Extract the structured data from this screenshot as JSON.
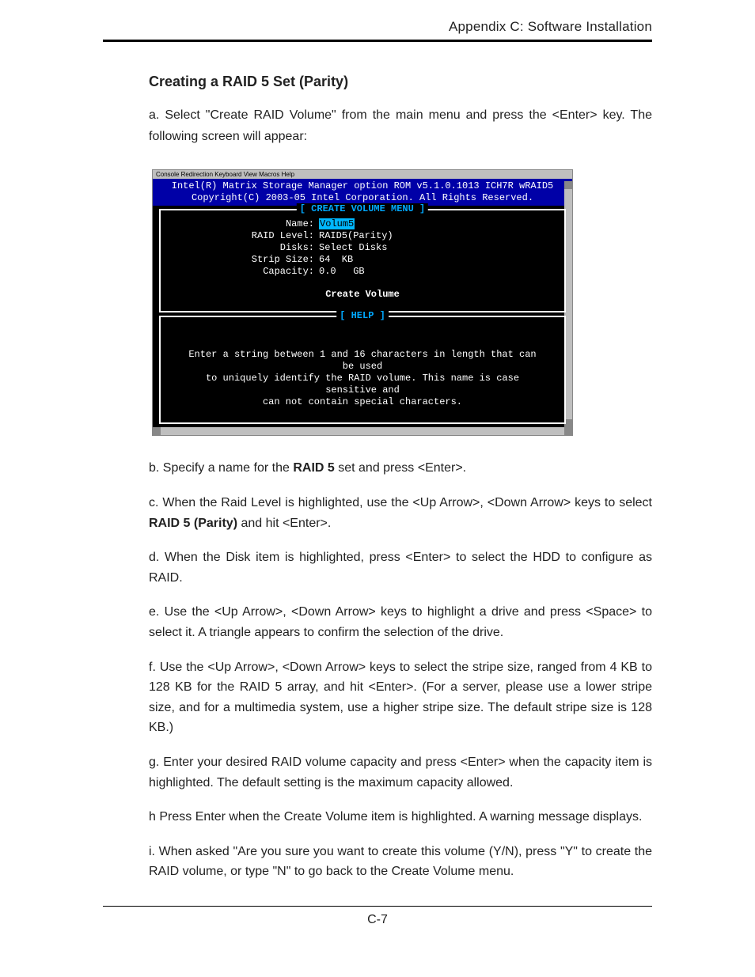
{
  "header": {
    "running_title": "Appendix C: Software Installation"
  },
  "section_title": "Creating a RAID 5 Set (Parity)",
  "intro": "a. Select \"Create RAID Volume\" from the main menu and press the <Enter> key. The following screen will appear:",
  "screenshot": {
    "menubar": "Console Redirection  Keyboard  View  Macros  Help",
    "banner_line1": "Intel(R) Matrix Storage Manager option ROM v5.1.0.1013 ICH7R wRAID5",
    "banner_line2": "Copyright(C) 2003-05 Intel Corporation.  All Rights Reserved.",
    "create_box_title": "[ CREATE VOLUME MENU ]",
    "fields": {
      "name_label": "Name:",
      "name_value": "Volum5",
      "raid_level_label": "RAID Level:",
      "raid_level_value": "RAID5(Parity)",
      "disks_label": "Disks:",
      "disks_value": "Select Disks",
      "strip_label": "Strip Size:",
      "strip_value": "64  KB",
      "capacity_label": "Capacity:",
      "capacity_value": "0.0   GB",
      "create_volume": "Create Volume"
    },
    "help_box_title": "[ HELP ]",
    "help_line1": "Enter a string between 1 and 16 characters in length that can be used",
    "help_line2": "to uniquely identify the RAID volume. This name is case sensitive and",
    "help_line3": "can not contain special characters."
  },
  "steps": {
    "b_pre": "b. Specify a name for the ",
    "b_bold": "RAID 5",
    "b_post": " set and press <Enter>.",
    "c_pre": "c. When the Raid Level is highlighted, use the <Up Arrow>, <Down Arrow> keys to select  ",
    "c_bold": "RAID 5 (Parity)",
    "c_post": " and hit <Enter>.",
    "d": "d. When the Disk item is highlighted, press <Enter> to select the HDD to configure as RAID.",
    "e": "e. Use  the <Up Arrow>, <Down Arrow> keys to highlight a drive and press <Space> to select it. A triangle appears to confirm the selection of the drive.",
    "f": "f. Use  the <Up Arrow>, <Down Arrow> keys to select the stripe size, ranged from 4 KB to 128 KB for the RAID 5 array, and hit <Enter>.  (For a server, please use a lower stripe size, and for a multimedia system, use a higher stripe size. The default stripe size is 128 KB.)",
    "g": "g. Enter your desired RAID volume capacity and press <Enter> when the capacity item is highlighted. The default setting is the maximum capacity allowed.",
    "h": "h  Press Enter when the Create Volume item is highlighted. A warning message displays.",
    "i": "i. When asked \"Are you sure you want to create this volume (Y/N), press \"Y\" to create the RAID volume, or type \"N\" to go back to the Create Volume menu."
  },
  "page_number": "C-7"
}
